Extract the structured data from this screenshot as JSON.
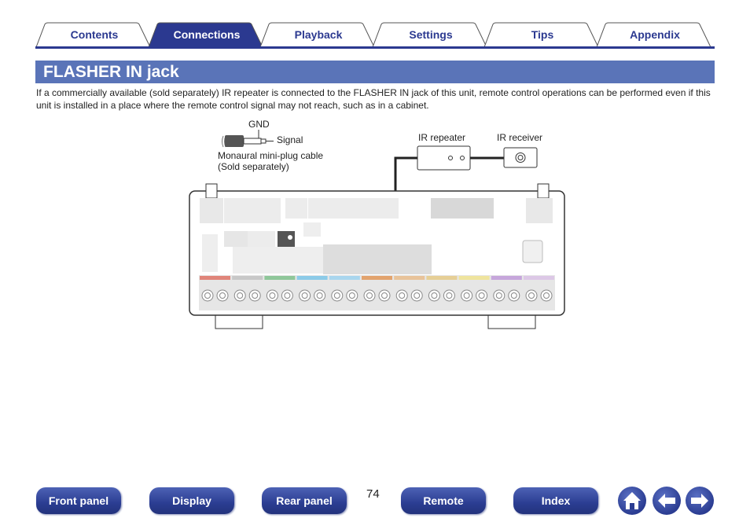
{
  "tabs": [
    {
      "label": "Contents",
      "active": false
    },
    {
      "label": "Connections",
      "active": true
    },
    {
      "label": "Playback",
      "active": false
    },
    {
      "label": "Settings",
      "active": false
    },
    {
      "label": "Tips",
      "active": false
    },
    {
      "label": "Appendix",
      "active": false
    }
  ],
  "section": {
    "title": "FLASHER IN jack",
    "intro": "If a commercially available (sold separately) IR repeater is connected to the FLASHER IN jack of this unit, remote control operations can be performed even if this unit is installed in a place where the remote control signal may not reach, such as in a cabinet."
  },
  "diagram": {
    "gnd_label": "GND",
    "signal_label": "Signal",
    "cable_label_1": "Monaural mini-plug cable",
    "cable_label_2": "(Sold separately)",
    "ir_repeater_label": "IR repeater",
    "ir_receiver_label": "IR receiver",
    "speaker_colors": [
      "#e0857a",
      "#c8c8c8",
      "#8fc79a",
      "#8ccbe8",
      "#a9d6ee",
      "#e2a36e",
      "#e8c39a",
      "#e6cf96",
      "#efe49e",
      "#c6a6db",
      "#dcc8e6"
    ]
  },
  "footer": {
    "buttons": [
      "Front panel",
      "Display",
      "Rear panel",
      "Remote",
      "Index"
    ],
    "page_number": "74",
    "icons": [
      "home-icon",
      "arrow-left-icon",
      "arrow-right-icon"
    ]
  },
  "colors": {
    "brand": "#2b3990",
    "header": "#5a74b8"
  }
}
